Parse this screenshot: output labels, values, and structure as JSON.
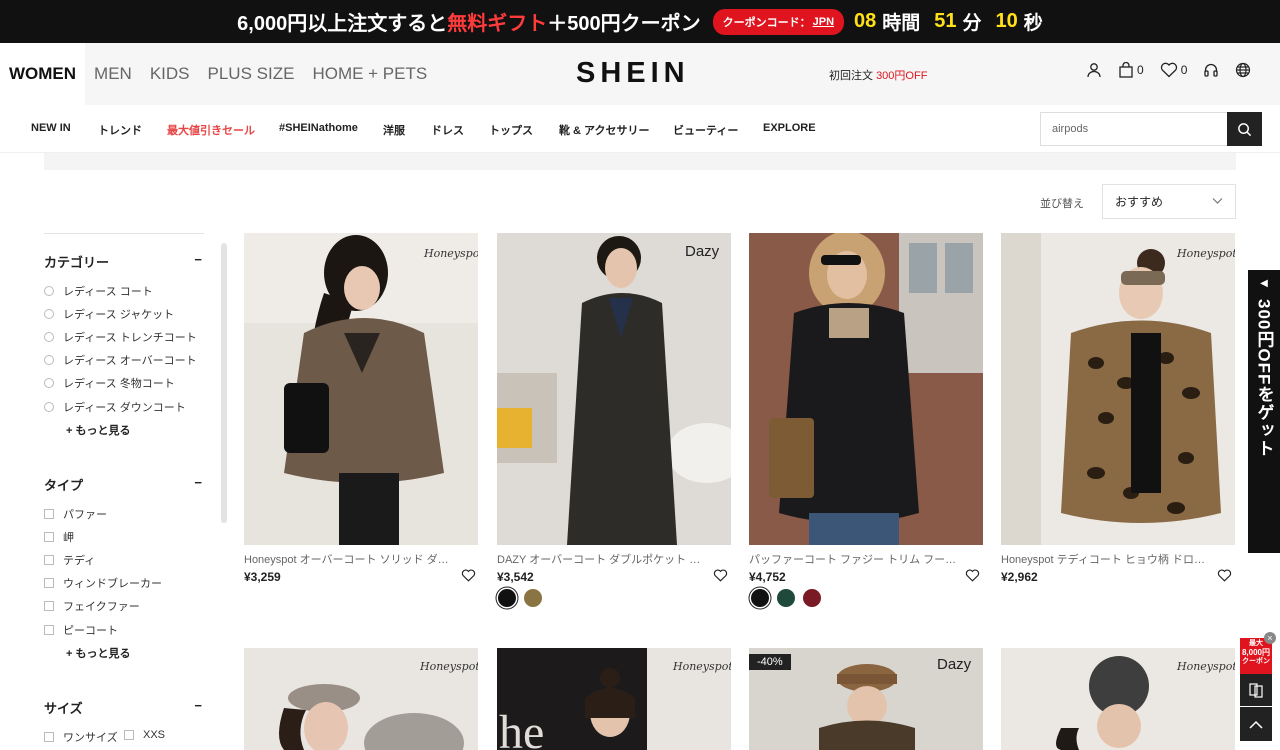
{
  "promo": {
    "text1": "6,000円以上注文すると",
    "text_red": "無料ギフト",
    "text2": "＋500円クーポン",
    "code_label": "クーポンコード：",
    "code": "JPN",
    "hours": "08",
    "hours_unit": "時間",
    "minutes": "51",
    "minutes_unit": "分",
    "seconds": "10",
    "seconds_unit": "秒"
  },
  "header": {
    "tabs": [
      "WOMEN",
      "MEN",
      "KIDS",
      "PLUS SIZE",
      "HOME + PETS"
    ],
    "logo": "SHEIN",
    "first_order_label": "初回注文",
    "first_order_value": "300円OFF",
    "bag_count": "0",
    "wishlist_count": "0"
  },
  "nav": {
    "items": [
      "NEW IN",
      "トレンド",
      "最大値引きセール",
      "#SHEINathome",
      "洋服",
      "ドレス",
      "トップス",
      "靴 & アクセサリー",
      "ビューティー",
      "EXPLORE"
    ],
    "search_value": "airpods"
  },
  "sort": {
    "label": "並び替え",
    "value": "おすすめ"
  },
  "filters": {
    "category": {
      "title": "カテゴリー",
      "options": [
        "レディース コート",
        "レディース ジャケット",
        "レディース トレンチコート",
        "レディース オーバーコート",
        "レディース 冬物コート",
        "レディース ダウンコート"
      ],
      "more": "もっと見る"
    },
    "type": {
      "title": "タイプ",
      "options": [
        "パファー",
        "岬",
        "テディ",
        "ウィンドブレーカー",
        "フェイクファー",
        "ピーコート"
      ],
      "more": "もっと見る"
    },
    "size": {
      "title": "サイズ",
      "options": [
        "ワンサイズ",
        "XXS"
      ]
    }
  },
  "products": [
    {
      "title": "Honeyspot オーバーコート ソリッド ダブルボタン",
      "price": "¥3,259",
      "brand_tag": "Honeyspot",
      "swatches": []
    },
    {
      "title": "DAZY オーバーコート ダブルポケット ダブルボタン",
      "price": "¥3,542",
      "brand_tag": "Dazy",
      "swatches": [
        "#111111",
        "#8a7443"
      ]
    },
    {
      "title": "パッファーコート ファジー トリム フード付き",
      "price": "¥4,752",
      "brand_tag": "",
      "swatches": [
        "#111111",
        "#1f4a3b",
        "#7a1a24"
      ]
    },
    {
      "title": "Honeyspot テディコート ヒョウ柄 ドロップショルダー",
      "price": "¥2,962",
      "brand_tag": "Honeyspot",
      "swatches": []
    }
  ],
  "products_row2": [
    {
      "brand_tag": "Honeyspot",
      "badge": ""
    },
    {
      "brand_tag": "Honeyspot",
      "badge": ""
    },
    {
      "brand_tag": "Dazy",
      "badge": "-40%"
    },
    {
      "brand_tag": "Honeyspot",
      "badge": ""
    }
  ],
  "side_promo": "300円OFFをゲット",
  "coupon_widget": {
    "line1": "最大",
    "line2": "8,000円",
    "line3": "クーポン"
  }
}
